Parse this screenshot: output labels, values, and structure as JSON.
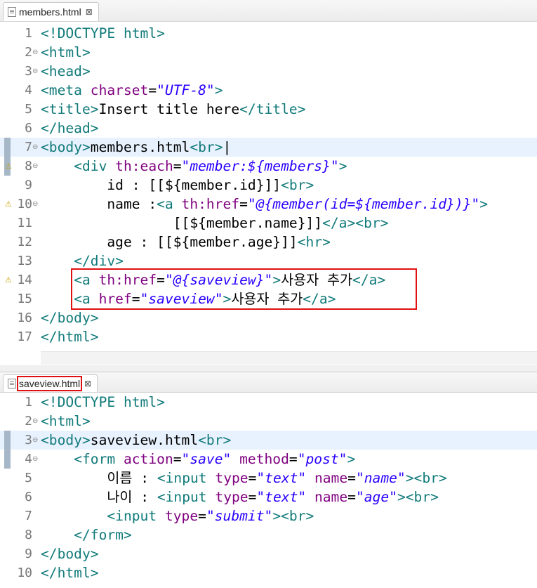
{
  "editor1": {
    "tab_label": "members.html",
    "close_glyph": "⊠",
    "lines": [
      {
        "n": "1",
        "html": "<span class='tg'>&lt;!DOCTYPE html&gt;</span>"
      },
      {
        "n": "2",
        "fold": "⊖",
        "html": "<span class='tg'>&lt;html&gt;</span>"
      },
      {
        "n": "3",
        "fold": "⊖",
        "html": "<span class='tg'>&lt;head&gt;</span>"
      },
      {
        "n": "4",
        "html": "<span class='tg'>&lt;meta</span> <span class='at'>charset</span>=<span class='vl'>\"UTF-8\"</span><span class='tg'>&gt;</span>"
      },
      {
        "n": "5",
        "html": "<span class='tg'>&lt;title&gt;</span>Insert title here<span class='tg'>&lt;/title&gt;</span>"
      },
      {
        "n": "6",
        "html": "<span class='tg'>&lt;/head&gt;</span>"
      },
      {
        "n": "7",
        "fold": "⊖",
        "current": true,
        "ruler": true,
        "html": "<span class='tg'>&lt;body&gt;</span>members.html<span class='tg'>&lt;br&gt;</span>|"
      },
      {
        "n": "8",
        "fold": "⊖",
        "warn": true,
        "ruler": true,
        "html": "    <span class='tg'>&lt;div</span> <span class='at'>th:each</span>=<span class='vl'>\"member:${members}\"</span><span class='tg'>&gt;</span>"
      },
      {
        "n": "9",
        "html": "        id : [[${member.id}]]<span class='tg'>&lt;br&gt;</span>"
      },
      {
        "n": "10",
        "fold": "⊖",
        "warn": true,
        "html": "        name :<span class='tg'>&lt;a</span> <span class='at'>th:href</span>=<span class='vl'>\"@{member(id=${member.id})}\"</span><span class='tg'>&gt;</span>"
      },
      {
        "n": "11",
        "html": "                [[${member.name}]]<span class='tg'>&lt;/a&gt;&lt;br&gt;</span>"
      },
      {
        "n": "12",
        "html": "        age : [[${member.age}]]<span class='tg'>&lt;hr&gt;</span>"
      },
      {
        "n": "13",
        "html": "    <span class='tg'>&lt;/div&gt;</span>"
      },
      {
        "n": "14",
        "warn": true,
        "html": "    <span class='tg'>&lt;a</span> <span class='at'>th:href</span>=<span class='vl'>\"@{saveview}\"</span><span class='tg'>&gt;</span>사용자 추가<span class='tg'>&lt;/a&gt;</span>"
      },
      {
        "n": "15",
        "html": "    <span class='tg'>&lt;a</span> <span class='at'>href</span>=<span class='vl'>\"saveview\"</span><span class='tg'>&gt;</span>사용자 추가<span class='tg'>&lt;/a&gt;</span>"
      },
      {
        "n": "16",
        "html": "<span class='tg'>&lt;/body&gt;</span>"
      },
      {
        "n": "17",
        "html": "<span class='tg'>&lt;/html&gt;</span>"
      }
    ]
  },
  "editor2": {
    "tab_label": "saveview.html",
    "close_glyph": "⊠",
    "lines": [
      {
        "n": "1",
        "html": "<span class='tg'>&lt;!DOCTYPE html&gt;</span>"
      },
      {
        "n": "2",
        "fold": "⊖",
        "html": "<span class='tg'>&lt;html&gt;</span>"
      },
      {
        "n": "3",
        "fold": "⊖",
        "current": true,
        "ruler": true,
        "html": "<span class='tg'>&lt;body&gt;</span>saveview.html<span class='tg'>&lt;br&gt;</span>"
      },
      {
        "n": "4",
        "fold": "⊖",
        "ruler": true,
        "html": "    <span class='tg'>&lt;form</span> <span class='at'>action</span>=<span class='vl'>\"save\"</span> <span class='at'>method</span>=<span class='vl'>\"post\"</span><span class='tg'>&gt;</span>"
      },
      {
        "n": "5",
        "html": "        이름 : <span class='tg'>&lt;input</span> <span class='at'>type</span>=<span class='vl'>\"text\"</span> <span class='at'>name</span>=<span class='vl'>\"name\"</span><span class='tg'>&gt;&lt;br&gt;</span>"
      },
      {
        "n": "6",
        "html": "        나이 : <span class='tg'>&lt;input</span> <span class='at'>type</span>=<span class='vl'>\"text\"</span> <span class='at'>name</span>=<span class='vl'>\"age\"</span><span class='tg'>&gt;&lt;br&gt;</span>"
      },
      {
        "n": "7",
        "html": "        <span class='tg'>&lt;input</span> <span class='at'>type</span>=<span class='vl'>\"submit\"</span><span class='tg'>&gt;&lt;br&gt;</span>"
      },
      {
        "n": "8",
        "html": "    <span class='tg'>&lt;/form&gt;</span>"
      },
      {
        "n": "9",
        "html": "<span class='tg'>&lt;/body&gt;</span>"
      },
      {
        "n": "10",
        "html": "<span class='tg'>&lt;/html&gt;</span>"
      }
    ]
  },
  "colors": {
    "tag": "#117a7a",
    "attribute": "#7f007f",
    "value": "#2a00ff",
    "highlight_box": "#e01010"
  }
}
